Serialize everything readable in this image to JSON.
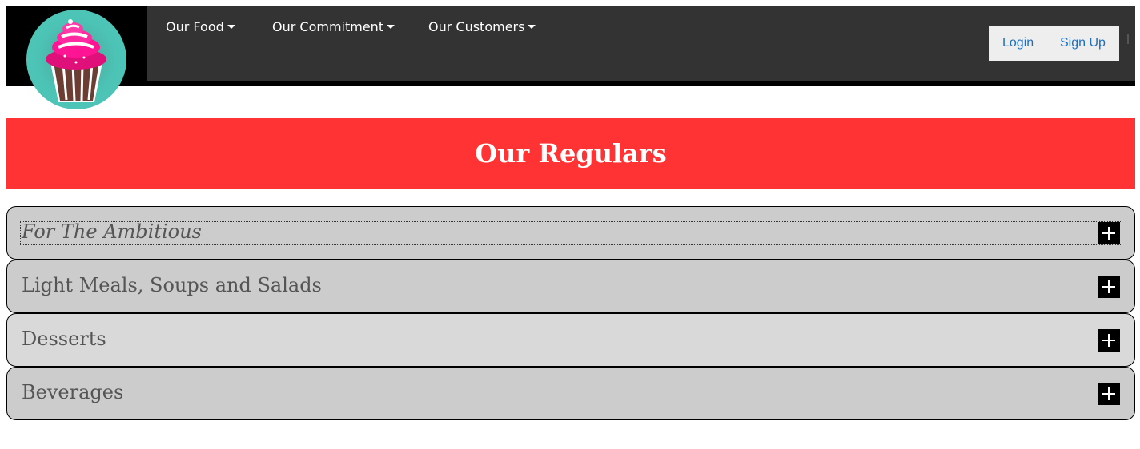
{
  "nav": {
    "items": [
      {
        "label": "Our Food"
      },
      {
        "label": "Our Commitment"
      },
      {
        "label": "Our Customers"
      }
    ],
    "login_label": "Login",
    "signup_label": "Sign Up"
  },
  "logo": {
    "icon": "cupcake-logo"
  },
  "banner": {
    "title": "Our Regulars"
  },
  "accordion": {
    "items": [
      {
        "label": "For The Ambitious",
        "state": "focused",
        "icon": "plus-icon"
      },
      {
        "label": "Light Meals, Soups and Salads",
        "state": "collapsed",
        "icon": "plus-icon"
      },
      {
        "label": "Desserts",
        "state": "hover",
        "icon": "plus-icon"
      },
      {
        "label": "Beverages",
        "state": "collapsed",
        "icon": "plus-icon"
      }
    ]
  },
  "colors": {
    "header_bg": "#333333",
    "banner_bg": "#ff3333",
    "accordion_bg": "#cccccc",
    "link_blue": "#1a6fbf"
  }
}
